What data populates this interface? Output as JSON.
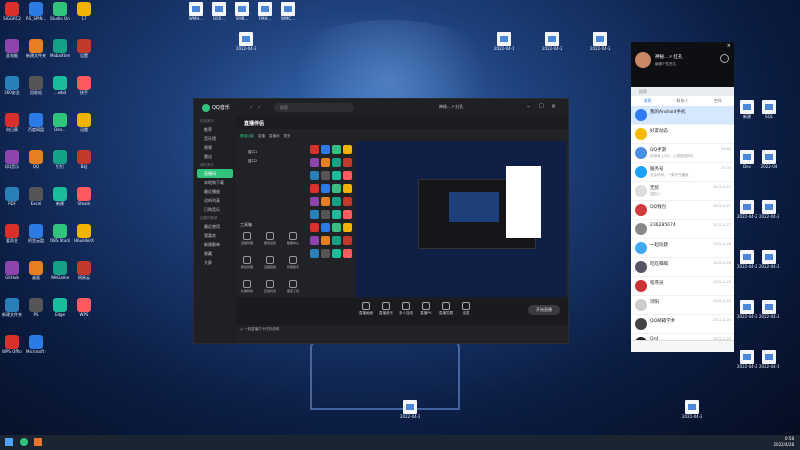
{
  "desktop_left": [
    {
      "label": "SIGGRC2"
    },
    {
      "label": "RS_SPIN..."
    },
    {
      "label": "Studio One"
    },
    {
      "label": "17"
    },
    {
      "label": "此电脑"
    },
    {
      "label": "新建文件夹"
    },
    {
      "label": "MobaXterm"
    },
    {
      "label": "设置"
    },
    {
      "label": "360安全"
    },
    {
      "label": "回收站"
    },
    {
      "label": "...wbd"
    },
    {
      "label": "快手"
    },
    {
      "label": "向日葵"
    },
    {
      "label": "百度网盘"
    },
    {
      "label": "Dev..."
    },
    {
      "label": "迅雷"
    },
    {
      "label": "QQ音乐"
    },
    {
      "label": "QQ"
    },
    {
      "label": "钉钉"
    },
    {
      "label": "B站"
    },
    {
      "label": "PDF"
    },
    {
      "label": "Excel"
    },
    {
      "label": "新建"
    },
    {
      "label": "Steam"
    },
    {
      "label": "爱奇艺"
    },
    {
      "label": "阿里云盘"
    },
    {
      "label": "OBS Studio"
    },
    {
      "label": "HbuilderX"
    },
    {
      "label": "GitHub"
    },
    {
      "label": "桌面"
    },
    {
      "label": "WeGame"
    },
    {
      "label": "网易云"
    },
    {
      "label": "新建文件夹"
    },
    {
      "label": "PS"
    },
    {
      "label": "Edge"
    },
    {
      "label": "WPS"
    },
    {
      "label": "WPS Office"
    },
    {
      "label": "Microsoft Edge"
    }
  ],
  "desktop_top_files": [
    {
      "label": "WMH..."
    },
    {
      "label": "DSR..."
    },
    {
      "label": "SMB..."
    },
    {
      "label": "FMH..."
    },
    {
      "label": "WMC..."
    }
  ],
  "desktop_mid_files": [
    {
      "label": "2022-04-22 14-21-06..."
    },
    {
      "label": "2022-04-19 14-27-09..."
    },
    {
      "label": "2022-04-23 13-37-06..."
    },
    {
      "label": "2022-04-22 14-21-06..."
    }
  ],
  "desktop_bottom_files": [
    {
      "label": "2022-04-25_1800_SMH"
    },
    {
      "label": "2022-04-25_ASDDSAB"
    }
  ],
  "qqmusic": {
    "app_name": "QQ音乐",
    "search_placeholder": "搜索",
    "user": "神秘...↗ 红孔",
    "sections": {
      "online": "在线音乐",
      "mine": "我的音乐"
    },
    "nav": [
      {
        "label": "推荐"
      },
      {
        "label": "音乐馆"
      },
      {
        "label": "视频"
      },
      {
        "label": "雷达"
      }
    ],
    "nav2": [
      {
        "label": "直播间",
        "active": true
      },
      {
        "label": "本地和下载"
      },
      {
        "label": "最近播放"
      },
      {
        "label": "试听列表"
      },
      {
        "label": "已购音乐"
      }
    ],
    "nav3_title": "创建的歌单",
    "nav3": [
      {
        "label": "最近使用"
      },
      {
        "label": "我喜欢"
      },
      {
        "label": "新建歌单"
      },
      {
        "label": "收藏"
      },
      {
        "label": "大屏"
      }
    ],
    "live": {
      "title": "直播伴侣",
      "tabs": [
        {
          "label": "基础功能"
        },
        {
          "label": "直播"
        },
        {
          "label": "直播间"
        },
        {
          "label": "更多"
        }
      ],
      "scene_items": [
        {
          "label": "窗口1"
        },
        {
          "label": "窗口2"
        }
      ],
      "toolbox_title": "工具箱",
      "tools": [
        {
          "label": "直播管理"
        },
        {
          "label": "推流设置"
        },
        {
          "label": "数据中心"
        },
        {
          "label": "粉丝管理"
        },
        {
          "label": "直播回放"
        },
        {
          "label": "智能助手"
        },
        {
          "label": "礼物特效"
        },
        {
          "label": "互动玩法"
        },
        {
          "label": "更多工具"
        }
      ],
      "bottom_buttons": [
        {
          "label": "直播画面"
        },
        {
          "label": "直播音乐"
        },
        {
          "label": "多人连线"
        },
        {
          "label": "直播PK"
        },
        {
          "label": "直播答题"
        },
        {
          "label": "连麦"
        }
      ],
      "go_live": "开始直播",
      "footer_note": "◎ 一起直播打卡任务说明"
    }
  },
  "qqpanel": {
    "username": "神秘...↗ 红孔",
    "signature": "编辑个性签名",
    "search_placeholder": "搜索",
    "tabs": [
      {
        "label": "消息"
      },
      {
        "label": "联系人"
      },
      {
        "label": "空间"
      }
    ],
    "rows": [
      {
        "name": "我的Android手机",
        "msg": "",
        "time": "",
        "color": "#2f7df6",
        "selected": true
      },
      {
        "name": "好友动态",
        "msg": "",
        "time": "",
        "color": "#f5b800"
      },
      {
        "name": "QQ手游",
        "msg": "玩游戏上QQ，上线就领好礼",
        "time": "23:46",
        "color": "#4a90e2"
      },
      {
        "name": "服务号",
        "msg": "北京时间，一周天气播报",
        "time": "23:33",
        "color": "#1aa1f3"
      },
      {
        "name": "无忧",
        "msg": "[图片]",
        "time": "2022-4-27",
        "color": "#ddd"
      },
      {
        "name": "QQ钱包",
        "msg": "",
        "time": "2022-4-27",
        "color": "#d23c3c"
      },
      {
        "name": "236285674",
        "msg": "",
        "time": "2022-4-27",
        "color": "#888"
      },
      {
        "name": "一起问题",
        "msg": "",
        "time": "2022-4-26",
        "color": "#3fa9f5"
      },
      {
        "name": "吃吃喝喝",
        "msg": "",
        "time": "2022-4-26",
        "color": "#556"
      },
      {
        "name": "程序员",
        "msg": "",
        "time": "2022-4-25",
        "color": "#c33"
      },
      {
        "name": "浏阳",
        "msg": "",
        "time": "2022-4-25",
        "color": "#ccc"
      },
      {
        "name": "QQ邮箱学术",
        "msg": "",
        "time": "2022-4-24",
        "color": "#444"
      },
      {
        "name": "Ord",
        "msg": "",
        "time": "2022-4-24",
        "color": "#222"
      }
    ]
  },
  "desktop_right": [
    {
      "label": "新建"
    },
    {
      "label": "SQL"
    },
    {
      "label": "Dev"
    },
    {
      "label": "2022-04"
    },
    {
      "label": "2022-04-27"
    },
    {
      "label": "2022-04-25"
    },
    {
      "label": "2022-04-25_1800"
    },
    {
      "label": "2022-04-23"
    },
    {
      "label": "2022-04-22"
    },
    {
      "label": "2022-04-21"
    },
    {
      "label": "2022-04-20"
    },
    {
      "label": "2022-04-19"
    }
  ],
  "clock": {
    "time": "0:58",
    "date": "2022/4/28"
  }
}
